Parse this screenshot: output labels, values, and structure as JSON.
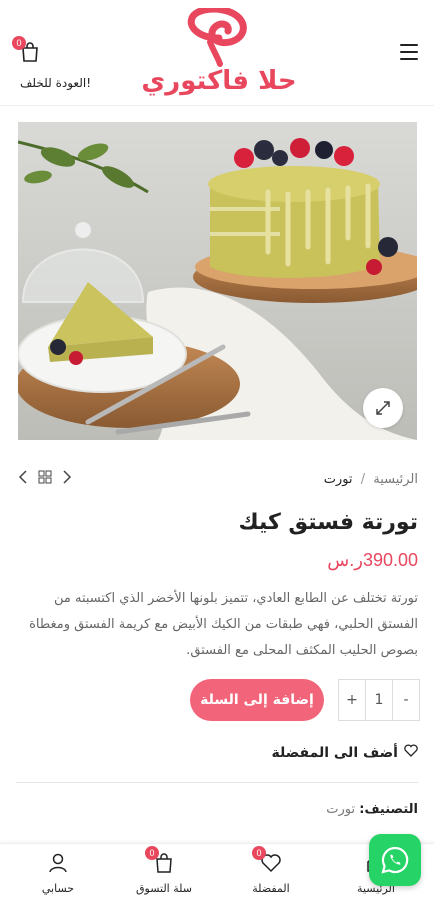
{
  "header": {
    "logo_text": "حلا فاكتوري",
    "back_label": "العودة للخلف!",
    "cart_count": "0"
  },
  "colors": {
    "accent": "#e8475e",
    "button": "#f16479",
    "whatsapp": "#25d366"
  },
  "icons": [
    "menu-icon",
    "cart-icon",
    "zoom-icon",
    "chevron-left-icon",
    "grid-icon",
    "chevron-right-icon",
    "heart-icon",
    "user-icon",
    "whatsapp-icon"
  ],
  "breadcrumb": {
    "home": "الرئيسية",
    "sep": "/",
    "current": "تورت"
  },
  "product": {
    "title": "تورتة فستق كيك",
    "price": "390.00ر.س",
    "description": "تورتة تختلف عن الطابع العادي، تتميز بلونها الأخضر الذي اكتسبته من الفستق الحلبي، فهي طبقات من الكيك الأبيض مع كريمة الفستق ومغطاة بصوص الحليب المكثف المحلى مع الفستق.",
    "quantity": "1",
    "minus": "-",
    "plus": "+",
    "add_to_cart": "إضافة إلى السلة",
    "wishlist": "أضف الى المفضلة",
    "category_label": "التصنيف:",
    "category_value": "تورت"
  },
  "bottom_nav": {
    "home": "الرئيسية",
    "wishlist": "المفضلة",
    "wishlist_count": "0",
    "cart": "سلة التسوق",
    "cart_count": "0",
    "account": "حسابي"
  }
}
